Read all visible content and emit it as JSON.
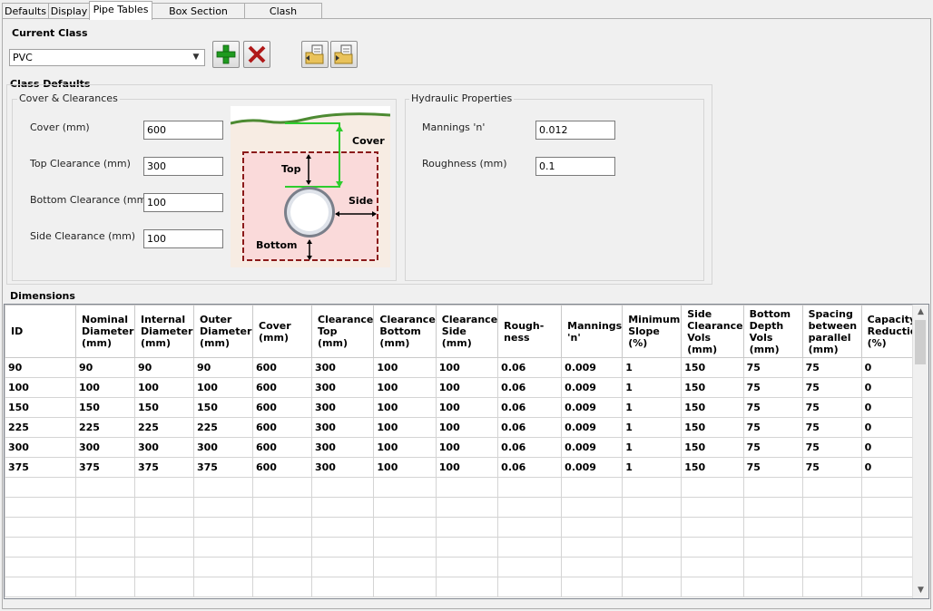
{
  "tabs": [
    "Defaults",
    "Display",
    "Pipe Tables",
    "Box Section Tables",
    "Clash Detection"
  ],
  "current_class": {
    "label": "Current Class",
    "value": "PVC"
  },
  "class_defaults": {
    "label": "Class Defaults",
    "cover_group_title": "Cover & Clearances",
    "fields": [
      {
        "label": "Cover (mm)",
        "value": "600"
      },
      {
        "label": "Top Clearance (mm)",
        "value": "300"
      },
      {
        "label": "Bottom Clearance (mm)",
        "value": "100"
      },
      {
        "label": "Side Clearance (mm)",
        "value": "100"
      }
    ],
    "diagram_labels": {
      "cover": "Cover",
      "top": "Top",
      "side": "Side",
      "bottom": "Bottom"
    },
    "hydraulic_group_title": "Hydraulic Properties",
    "hydraulic_fields": [
      {
        "label": "Mannings 'n'",
        "value": "0.012"
      },
      {
        "label": "Roughness (mm)",
        "value": "0.1"
      }
    ]
  },
  "dimensions": {
    "label": "Dimensions",
    "columns": [
      [
        "ID"
      ],
      [
        "Nominal",
        "Diameter",
        "(mm)"
      ],
      [
        "Internal",
        "Diameter",
        "(mm)"
      ],
      [
        "Outer",
        "Diameter",
        "(mm)"
      ],
      [
        "Cover",
        "(mm)"
      ],
      [
        "Clearance",
        "Top",
        "(mm)"
      ],
      [
        "Clearance",
        "Bottom",
        "(mm)"
      ],
      [
        "Clearance",
        "Side",
        "(mm)"
      ],
      [
        "Rough-",
        "ness"
      ],
      [
        "Mannings",
        "'n'"
      ],
      [
        "Minimum",
        "Slope",
        "(%)"
      ],
      [
        "Side",
        "Clearance",
        "Vols",
        "(mm)"
      ],
      [
        "Bottom",
        "Depth",
        "Vols",
        "(mm)"
      ],
      [
        "Spacing",
        "between",
        "parallel",
        "(mm)"
      ],
      [
        "Capacity",
        "Reduction",
        "(%)"
      ]
    ],
    "rows": [
      [
        "90",
        "90",
        "90",
        "90",
        "600",
        "300",
        "100",
        "100",
        "0.06",
        "0.009",
        "1",
        "150",
        "75",
        "75",
        "0"
      ],
      [
        "100",
        "100",
        "100",
        "100",
        "600",
        "300",
        "100",
        "100",
        "0.06",
        "0.009",
        "1",
        "150",
        "75",
        "75",
        "0"
      ],
      [
        "150",
        "150",
        "150",
        "150",
        "600",
        "300",
        "100",
        "100",
        "0.06",
        "0.009",
        "1",
        "150",
        "75",
        "75",
        "0"
      ],
      [
        "225",
        "225",
        "225",
        "225",
        "600",
        "300",
        "100",
        "100",
        "0.06",
        "0.009",
        "1",
        "150",
        "75",
        "75",
        "0"
      ],
      [
        "300",
        "300",
        "300",
        "300",
        "600",
        "300",
        "100",
        "100",
        "0.06",
        "0.009",
        "1",
        "150",
        "75",
        "75",
        "0"
      ],
      [
        "375",
        "375",
        "375",
        "375",
        "600",
        "300",
        "100",
        "100",
        "0.06",
        "0.009",
        "1",
        "150",
        "75",
        "75",
        "0"
      ]
    ],
    "empty_rows": 6
  },
  "icons": [
    "add-icon",
    "delete-icon",
    "import-icon",
    "export-icon",
    "chevron-down-icon",
    "scroll-up-icon",
    "scroll-down-icon"
  ]
}
